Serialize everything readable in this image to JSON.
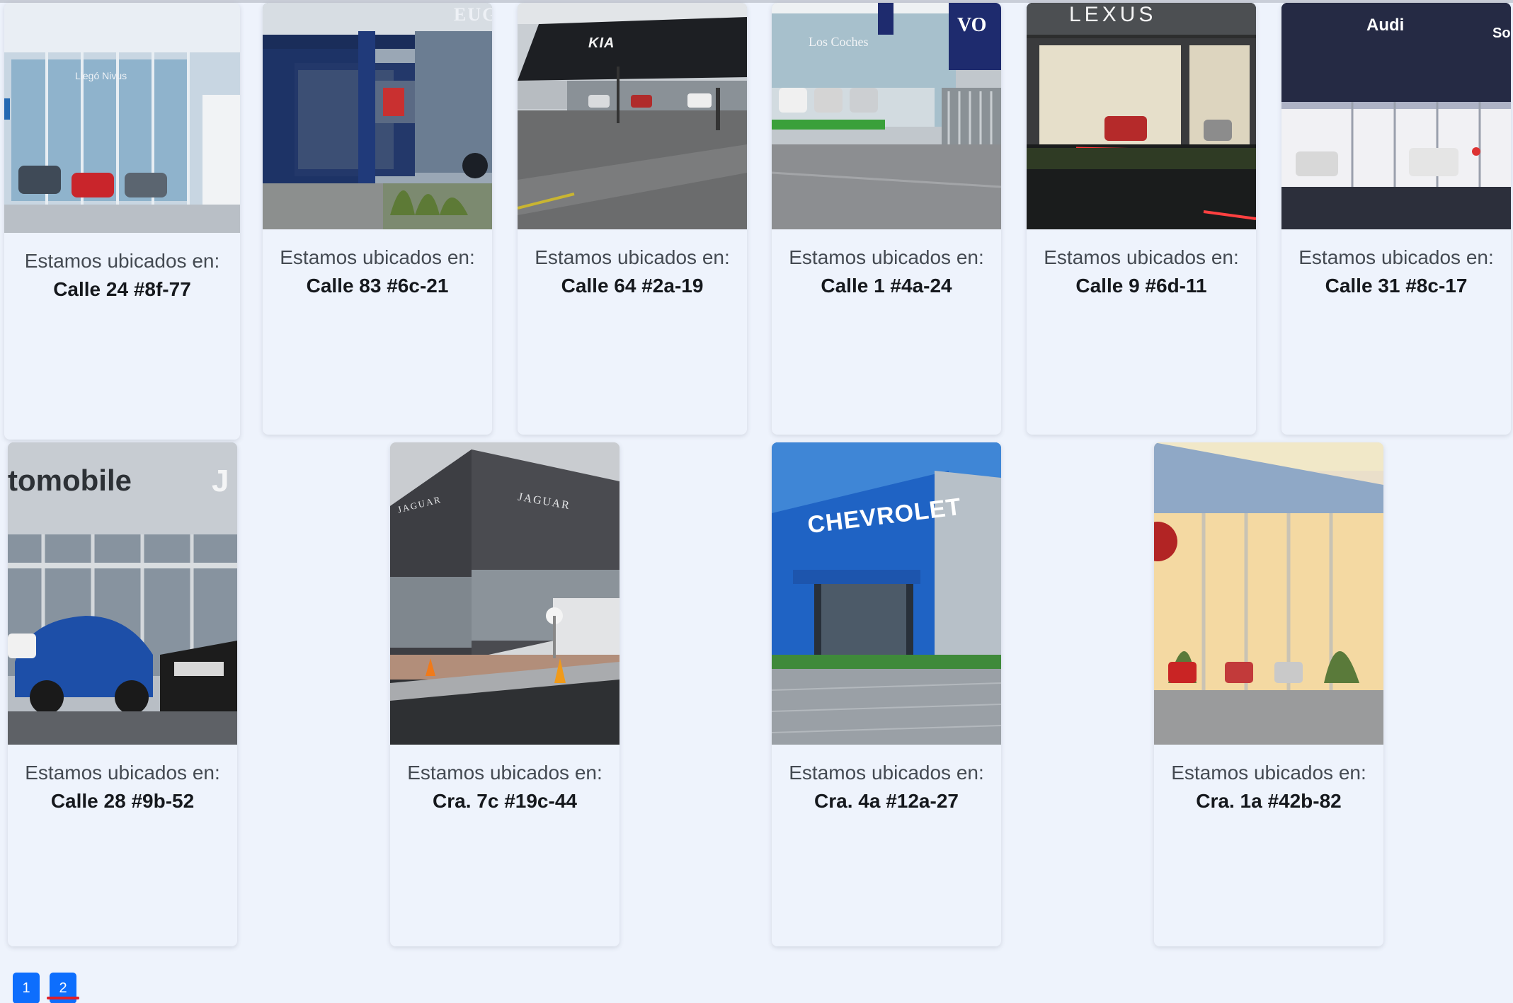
{
  "dealerships": [
    {
      "caption": "Estamos ubicados en:",
      "address": "Calle 24 #8f-77",
      "brand_sign": "Llegó Nivus"
    },
    {
      "caption": "Estamos ubicados en:",
      "address": "Calle 83 #6c-21",
      "brand_sign": "EUGE"
    },
    {
      "caption": "Estamos ubicados en:",
      "address": "Calle 64 #2a-19",
      "brand_sign": "KIA"
    },
    {
      "caption": "Estamos ubicados en:",
      "address": "Calle 1 #4a-24",
      "brand_sign": "Los Coches"
    },
    {
      "caption": "Estamos ubicados en:",
      "address": "Calle 9 #6d-11",
      "brand_sign": "LEXUS"
    },
    {
      "caption": "Estamos ubicados en:",
      "address": "Calle 31 #8c-17",
      "brand_sign": "Audi"
    },
    {
      "caption": "Estamos ubicados en:",
      "address": "Calle 28 #9b-52",
      "brand_sign": "tomobile"
    },
    {
      "caption": "Estamos ubicados en:",
      "address": "Cra. 7c #19c-44",
      "brand_sign": "JAGUAR"
    },
    {
      "caption": "Estamos ubicados en:",
      "address": "Cra. 4a #12a-27",
      "brand_sign": "CHEVROLET"
    },
    {
      "caption": "Estamos ubicados en:",
      "address": "Cra. 1a #42b-82",
      "brand_sign": ""
    }
  ],
  "pagination": {
    "pages": [
      "1",
      "2"
    ],
    "current": "2"
  },
  "colors": {
    "page_bg": "#eef3fc",
    "pager_button": "#0d6efd",
    "active_underline": "#e0202a"
  }
}
